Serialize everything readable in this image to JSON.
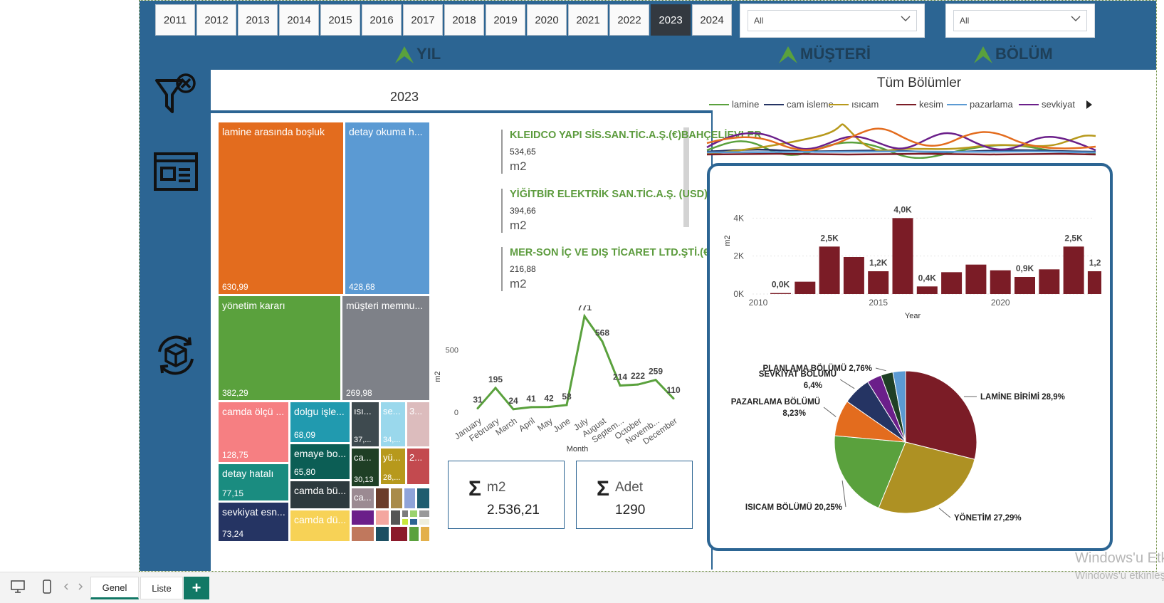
{
  "years": [
    "2011",
    "2012",
    "2013",
    "2014",
    "2015",
    "2016",
    "2017",
    "2018",
    "2019",
    "2020",
    "2021",
    "2022",
    "2023",
    "2024"
  ],
  "selected_year": "2023",
  "filters": {
    "musteri": {
      "label": "MÜŞTERİ",
      "value": "All"
    },
    "bolum": {
      "label": "BÖLÜM",
      "value": "All"
    },
    "yil": {
      "label": "YIL"
    }
  },
  "colors": {
    "brand": "#2c6593",
    "accent_green": "#5c9b3d",
    "bar": "#7b1c26"
  },
  "treemap": {
    "title": "2023",
    "tiles": [
      {
        "label": "lamine arasında boşluk",
        "value": "630,99",
        "color": "#e36c1e"
      },
      {
        "label": "detay okuma h...",
        "value": "428,68",
        "color": "#5b9ad3"
      },
      {
        "label": "yönetim kararı",
        "value": "382,29",
        "color": "#5aa13d"
      },
      {
        "label": "müşteri memnu...",
        "value": "269,98",
        "color": "#7e8188"
      },
      {
        "label": "camda ölçü ...",
        "value": "128,75",
        "color": "#f67f82"
      },
      {
        "label": "dolgu işle...",
        "value": "68,09",
        "color": "#219aaf"
      },
      {
        "label": "ısı...",
        "value": "37,...",
        "color": "#3e4a4f"
      },
      {
        "label": "se...",
        "value": "34,...",
        "color": "#9ad8ec"
      },
      {
        "label": "3...",
        "value": "",
        "color": "#dcbcbd"
      },
      {
        "label": "emaye bo...",
        "value": "65,80",
        "color": "#0c5e55"
      },
      {
        "label": "ca...",
        "value": "30,13",
        "color": "#1f3f25"
      },
      {
        "label": "yü...",
        "value": "28,...",
        "color": "#b7991c"
      },
      {
        "label": "2...",
        "value": "",
        "color": "#c34a4f"
      },
      {
        "label": "detay hatalı",
        "value": "77,15",
        "color": "#1a8c80"
      },
      {
        "label": "camda bü...",
        "value": "",
        "color": "#2e3a3e"
      },
      {
        "label": "ca...",
        "value": "",
        "color": "#9b8a92"
      },
      {
        "label": "sevkiyat esn...",
        "value": "73,24",
        "color": "#253463"
      },
      {
        "label": "camda dü...",
        "value": "",
        "color": "#f7d256"
      }
    ]
  },
  "customers": [
    {
      "name": "KLEIDCO YAPI SİS.SAN.TİC.A.Ş.(€)BAHÇELİEVLER",
      "value": "534,65",
      "unit": "m2"
    },
    {
      "name": "YİĞİTBİR ELEKTRİK SAN.TİC.A.Ş. (USD)",
      "value": "394,66",
      "unit": "m2"
    },
    {
      "name": "MER-SON İÇ VE DIŞ TİCARET LTD.ŞTİ.(€)",
      "value": "216,88",
      "unit": "m2"
    }
  ],
  "kpis": [
    {
      "label": "m2",
      "value": "2.536,21",
      "symbol": "Σ"
    },
    {
      "label": "Adet",
      "value": "1290",
      "symbol": "Σ"
    }
  ],
  "tum_bolumler": {
    "title": "Tüm Bölümler",
    "legend": [
      {
        "name": "lamine",
        "color": "#5aa13d"
      },
      {
        "name": "cam isleme",
        "color": "#253463"
      },
      {
        "name": "ısıcam",
        "color": "#b7991c"
      },
      {
        "name": "kesim",
        "color": "#7b1c26"
      },
      {
        "name": "pazarlama",
        "color": "#5b9ad3"
      },
      {
        "name": "sevkiyat",
        "color": "#6b1f8a"
      }
    ]
  },
  "chart_data": [
    {
      "type": "line",
      "id": "monthly",
      "xlabel": "Month",
      "ylabel": "m2",
      "categories": [
        "January",
        "February",
        "March",
        "April",
        "May",
        "June",
        "July",
        "August",
        "Septem...",
        "October",
        "Novemb...",
        "December"
      ],
      "values": [
        31,
        195,
        24,
        41,
        42,
        58,
        771,
        568,
        214,
        222,
        259,
        110
      ],
      "yticks": [
        0,
        500
      ],
      "ylim": [
        0,
        800
      ],
      "color": "#5aa13d"
    },
    {
      "type": "bar",
      "id": "yearly",
      "xlabel": "Year",
      "ylabel": "m2",
      "x": [
        2011,
        2012,
        2013,
        2014,
        2015,
        2016,
        2017,
        2018,
        2019,
        2020,
        2021,
        2022,
        2023,
        2024
      ],
      "values": [
        0.05,
        0.65,
        2.5,
        1.95,
        1.2,
        4.0,
        0.4,
        1.15,
        1.55,
        1.25,
        0.9,
        1.3,
        2.5,
        1.2
      ],
      "data_labels": [
        "0,0K",
        "",
        "2,5K",
        "",
        "1,2K",
        "4,0K",
        "0,4K",
        "",
        "",
        "",
        "0,9K",
        "",
        "2,5K",
        "1,2K"
      ],
      "yticks": [
        "0K",
        "2K",
        "4K"
      ],
      "xticks": [
        "2010",
        "2015",
        "2020"
      ],
      "ylim": [
        0,
        4.5
      ],
      "color": "#7b1c26"
    },
    {
      "type": "pie",
      "id": "bolum-pie",
      "slices": [
        {
          "label": "LAMİNE BİRİMİ 28,9%",
          "value": 28.9,
          "color": "#7b1c26"
        },
        {
          "label": "YÖNETİM 27,29%",
          "value": 27.29,
          "color": "#ae9123"
        },
        {
          "label": "ISICAM BÖLÜMÜ 20,25%",
          "value": 20.25,
          "color": "#5aa13d"
        },
        {
          "label": "PAZARLAMA BÖLÜMÜ\n8,23%",
          "value": 8.23,
          "color": "#e36c1e"
        },
        {
          "label": "SEVKİYAT BÖLÜMÜ\n6,4%",
          "value": 6.4,
          "color": "#253463"
        },
        {
          "label": "",
          "value": 3.3,
          "color": "#6b1f8a"
        },
        {
          "label": "PLANLAMA BÖLÜMÜ 2,76%",
          "value": 2.76,
          "color": "#1f3f25"
        },
        {
          "label": "",
          "value": 2.87,
          "color": "#5b9ad3"
        }
      ]
    }
  ],
  "tabs": [
    "Genel",
    "Liste"
  ],
  "watermark": {
    "line1": "Windows'u Etk",
    "line2": "Windows'u etkinleşt"
  }
}
